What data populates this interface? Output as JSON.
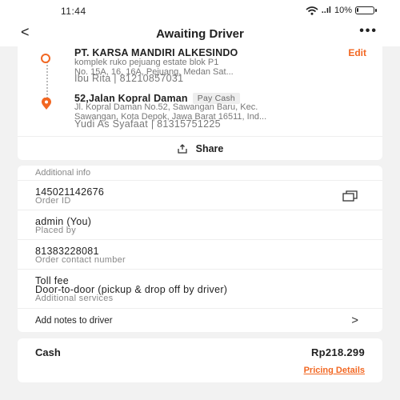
{
  "status_bar": {
    "time": "11:44",
    "signal_text": "..ıl",
    "battery_percent": "10%",
    "battery_level": 0.1
  },
  "app_bar": {
    "back_icon": "back-arrow-icon",
    "title": "Awaiting Driver",
    "more_icon": "more-dots-icon"
  },
  "route": {
    "edit_label": "Edit",
    "origin": {
      "name": "PT. KARSA MANDIRI ALKESINDO",
      "address_line1": "komplek ruko pejuang estate blok P1",
      "address_line2": "No. 15A, 16, 16A, Pejuang, Medan Sat...",
      "contact": "Ibu Rita | 81210857031"
    },
    "destination": {
      "name": "52,Jalan Kopral Daman",
      "payment_badge": "Pay Cash",
      "address_line1": "Jl. Kopral Daman No.52, Sawangan Baru, Kec.",
      "address_line2": "Sawangan, Kota Depok, Jawa Barat 16511, Ind...",
      "contact": "Yudi As Syafaat | 81315751225"
    },
    "share_label": "Share"
  },
  "additional_info": {
    "header": "Additional info",
    "order_id": {
      "value": "145021142676",
      "label": "Order ID"
    },
    "placed_by": {
      "value": "admin (You)",
      "label": "Placed by"
    },
    "contact_number": {
      "value": "81383228081",
      "label": "Order contact number"
    },
    "services": {
      "line1": "Toll fee",
      "line2": "Door-to-door (pickup & drop off by driver)",
      "label": "Additional services"
    },
    "notes_label": "Add notes to driver"
  },
  "payment": {
    "method": "Cash",
    "amount": "Rp218.299",
    "details_link": "Pricing Details"
  },
  "colors": {
    "accent": "#f26722",
    "background": "#f2f2f2",
    "card": "#ffffff",
    "muted_text": "#888888"
  }
}
